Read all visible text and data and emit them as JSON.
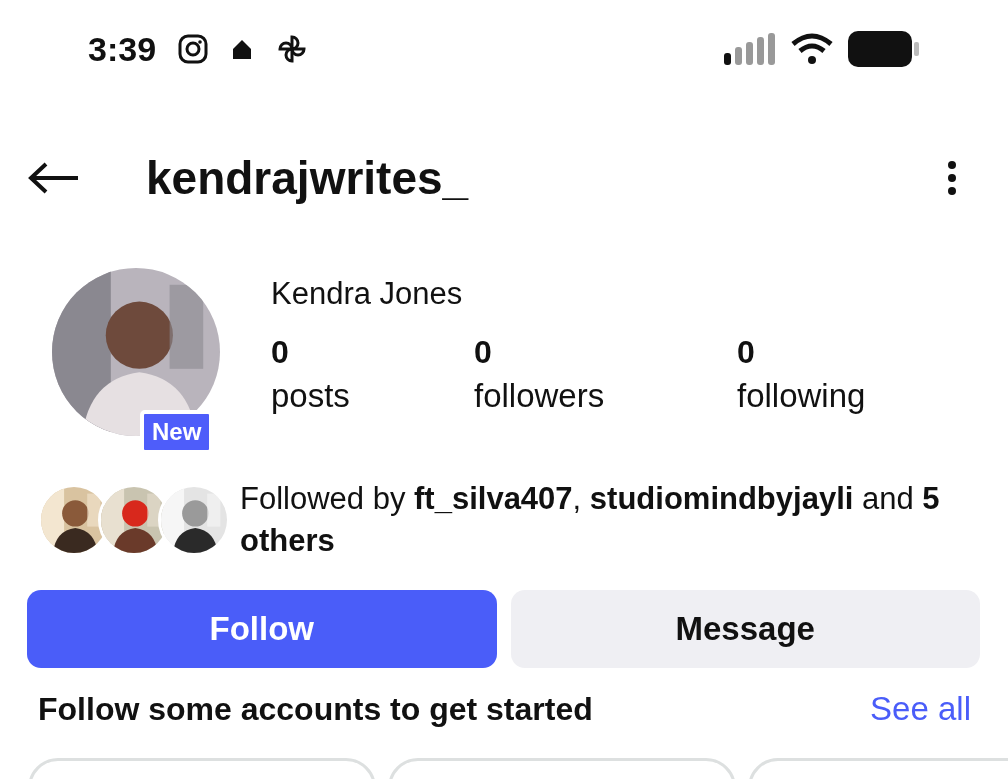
{
  "status_bar": {
    "time": "3:39"
  },
  "header": {
    "username": "kendrajwrites_"
  },
  "profile": {
    "badge": "New",
    "name": "Kendra Jones",
    "stats": [
      {
        "count": "0",
        "label": "posts"
      },
      {
        "count": "0",
        "label": "followers"
      },
      {
        "count": "0",
        "label": "following"
      }
    ]
  },
  "followed_by": {
    "text": "Followed by **ft_silva407**, **studiomindbyjayli** and **5 others**"
  },
  "buttons": [
    {
      "label": "Follow",
      "kind": "primary"
    },
    {
      "label": "Message",
      "kind": "secondary"
    }
  ],
  "suggestions": {
    "title": "Follow some accounts to get started",
    "link": "See all",
    "cards": [
      {
        "kind": "card"
      },
      {
        "kind": "card"
      },
      {
        "kind": "card"
      }
    ]
  }
}
